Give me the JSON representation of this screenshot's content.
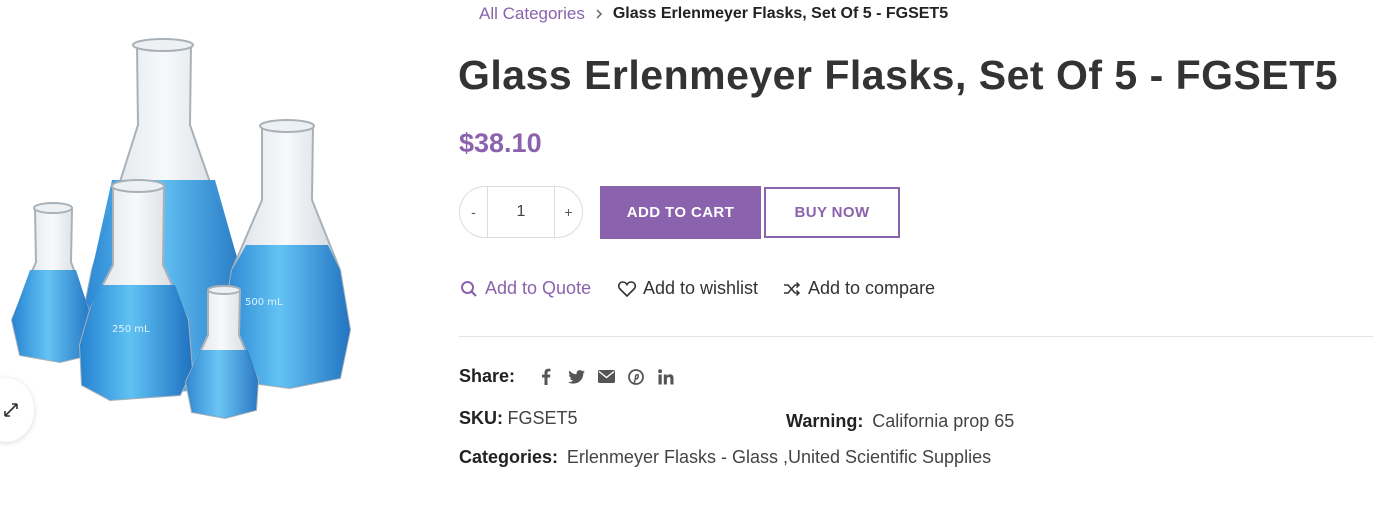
{
  "breadcrumb": {
    "root": "All Categories",
    "current": "Glass Erlenmeyer Flasks, Set Of 5 - FGSET5"
  },
  "product": {
    "title": "Glass Erlenmeyer Flasks, Set Of 5 - FGSET5",
    "price": "$38.10",
    "quantity": "1",
    "qty_minus": "-",
    "qty_plus": "+",
    "add_to_cart": "ADD TO CART",
    "buy_now": "BUY NOW"
  },
  "actions": {
    "quote": "Add to Quote",
    "wishlist": "Add to wishlist",
    "compare": "Add to compare"
  },
  "share": {
    "label": "Share:",
    "networks": [
      "facebook",
      "twitter",
      "email",
      "pinterest",
      "linkedin"
    ]
  },
  "meta": {
    "sku_label": "SKU:",
    "sku_value": "FGSET5",
    "warning_label": "Warning:",
    "warning_value": "California prop 65",
    "categories_label": "Categories:",
    "categories_value": "Erlenmeyer Flasks - Glass ,United Scientific Supplies"
  },
  "image": {
    "flask_labels": [
      "250 mL",
      "500 mL"
    ]
  },
  "colors": {
    "accent": "#8b62ae",
    "text": "#333333",
    "liquid": "#3a9fe0"
  }
}
